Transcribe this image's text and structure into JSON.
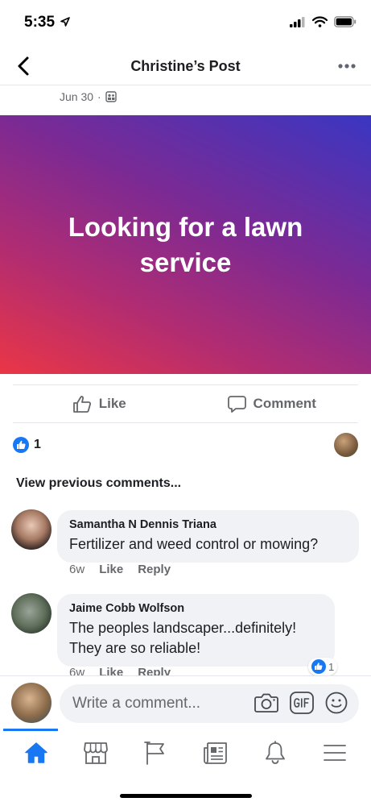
{
  "status": {
    "time": "5:35"
  },
  "nav": {
    "title": "Christine’s Post"
  },
  "post": {
    "date": "Jun 30",
    "separator": "·",
    "banner_text": "Looking for a lawn service",
    "banner_colors": [
      "#ea3646",
      "#b12c72",
      "#7b2a94",
      "#3a36c2"
    ]
  },
  "actions": {
    "like": "Like",
    "comment": "Comment"
  },
  "reactions": {
    "count": "1"
  },
  "comments_section": {
    "view_previous": "View previous comments..."
  },
  "comments": [
    {
      "name": "Samantha N Dennis Triana",
      "text": "Fertilizer and weed control or mowing?",
      "time": "6w",
      "like": "Like",
      "reply": "Reply"
    },
    {
      "name": "Jaime Cobb Wolfson",
      "text_line1": "The peoples landscaper...definitely!",
      "text_line2": "They are so reliable!",
      "time": "6w",
      "like": "Like",
      "reply": "Reply",
      "reaction_count": "1"
    }
  ],
  "composer": {
    "placeholder": "Write a comment..."
  },
  "colors": {
    "accent": "#1877f2",
    "muted": "#65676b",
    "bubble": "#f0f2f5"
  },
  "tabs": [
    "home-icon",
    "marketplace-icon",
    "pages-flag-icon",
    "news-icon",
    "notifications-bell-icon",
    "menu-icon"
  ]
}
